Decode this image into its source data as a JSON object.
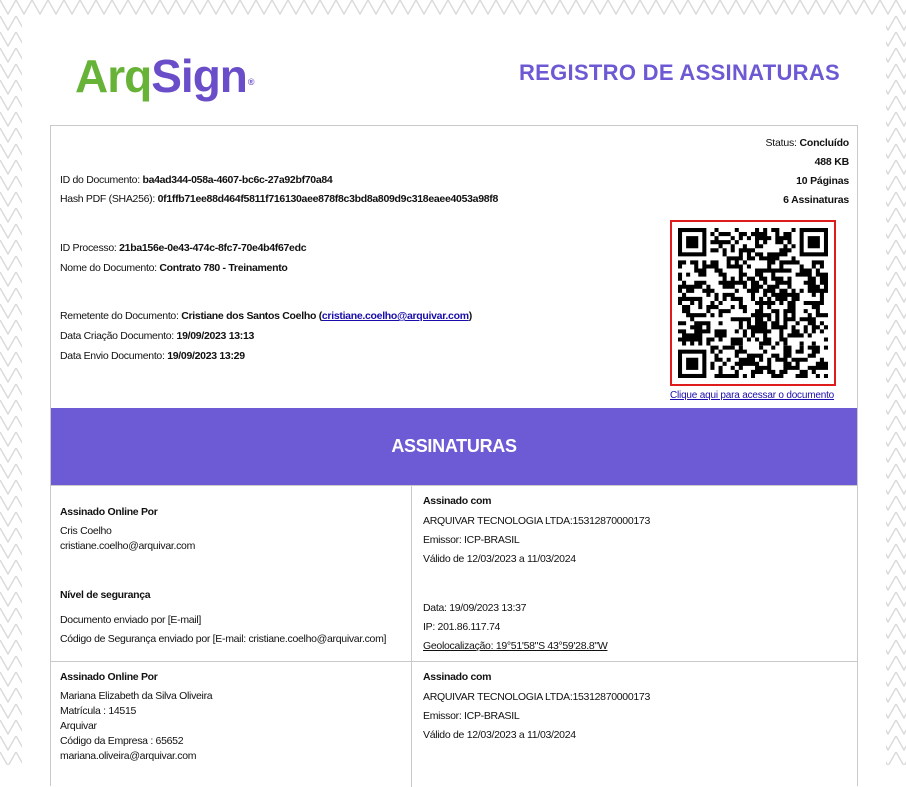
{
  "brand": {
    "arq": "Arq",
    "sign": "Sign",
    "reg": "®"
  },
  "title": "REGISTRO DE ASSINATURAS",
  "colors": {
    "accent": "#6d5ad5",
    "brand_green": "#67b337",
    "qr_border": "#e01b1b"
  },
  "status": {
    "status_label": "Status:",
    "status_value": "Concluído",
    "size": "488 KB",
    "pages": "10 Páginas",
    "signatures": "6 Assinaturas"
  },
  "document": {
    "id_label": "ID do Documento:",
    "id_value": "ba4ad344-058a-4607-bc6c-27a92bf70a84",
    "hash_label": "Hash PDF (SHA256):",
    "hash_value": "0f1ffb71ee88d464f5811f716130aee878f8c3bd8a809d9c318eaee4053a98f8",
    "process_label": "ID Processo:",
    "process_value": "21ba156e-0e43-474c-8fc7-70e4b4f67edc",
    "name_label": "Nome do Documento:",
    "name_value": "Contrato 780 - Treinamento",
    "sender_label": "Remetente do Documento:",
    "sender_name": "Cristiane dos Santos Coelho",
    "sender_open": "(",
    "sender_email": "cristiane.coelho@arquivar.com",
    "sender_close": ")",
    "created_label": "Data Criação Documento:",
    "created_value": "19/09/2023 13:13",
    "sent_label": "Data Envio Documento:",
    "sent_value": "19/09/2023 13:29"
  },
  "qr": {
    "link_text": "Clique aqui para acessar o documento",
    "icon": "qr-code-icon"
  },
  "section_title": "ASSINATURAS",
  "signers": [
    {
      "signed_by_label": "Assinado Online Por",
      "lines": [
        "Cris Coelho",
        "cristiane.coelho@arquivar.com"
      ],
      "security_label": "Nível de segurança",
      "security_lines": [
        "Documento enviado por [E-mail]",
        "Código de Segurança enviado por [E-mail: cristiane.coelho@arquivar.com]"
      ],
      "signed_with_label": "Assinado com",
      "cert_lines": [
        "ARQUIVAR TECNOLOGIA LTDA:15312870000173",
        "Emissor: ICP-BRASIL",
        "Válido de 12/03/2023 a 11/03/2024"
      ],
      "meta_lines": [
        "Data: 19/09/2023 13:37",
        "IP: 201.86.117.74",
        "Geolocalização: 19°51'58\"S 43°59'28.8\"W"
      ]
    },
    {
      "signed_by_label": "Assinado Online Por",
      "lines": [
        "Mariana Elizabeth da Silva Oliveira",
        "Matrícula : 14515",
        "Arquivar",
        "Código da Empresa : 65652",
        "mariana.oliveira@arquivar.com"
      ],
      "signed_with_label": "Assinado com",
      "cert_lines": [
        "ARQUIVAR TECNOLOGIA LTDA:15312870000173",
        "Emissor: ICP-BRASIL",
        "Válido de 12/03/2023 a 11/03/2024"
      ]
    }
  ]
}
